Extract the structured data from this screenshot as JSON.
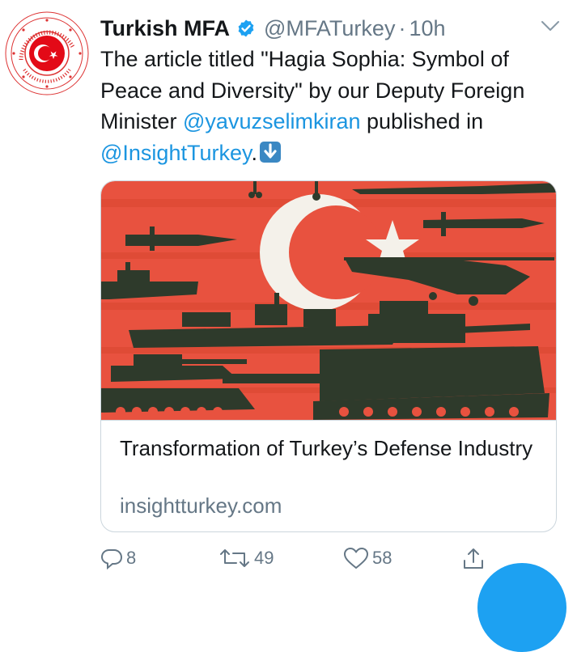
{
  "account": {
    "display_name": "Turkish MFA",
    "handle": "@MFATurkey",
    "separator": "·",
    "time": "10h",
    "avatar_text_outer": "REPUBLIC OF TURKEY MINISTRY OF FOREIGN AFFAIRS"
  },
  "tweet": {
    "text_part1": "The article titled \"Hagia Sophia: Symbol of Peace and Diversity\" by our Deputy Foreign Minister ",
    "mention1": "@yavuzselimkiran",
    "text_part2": " published in ",
    "mention2": "@InsightTurkey",
    "text_part3": ".",
    "emoji": "down-arrow-emoji"
  },
  "card": {
    "title": "Transformation of Turkey’s Defense Industry",
    "domain": "insightturkey.com"
  },
  "actions": {
    "replies": "8",
    "retweets": "49",
    "likes": "58"
  },
  "colors": {
    "link": "#1b95e0",
    "secondary": "#657786",
    "flag_red": "#e8523f",
    "brand_blue": "#1da1f2"
  }
}
